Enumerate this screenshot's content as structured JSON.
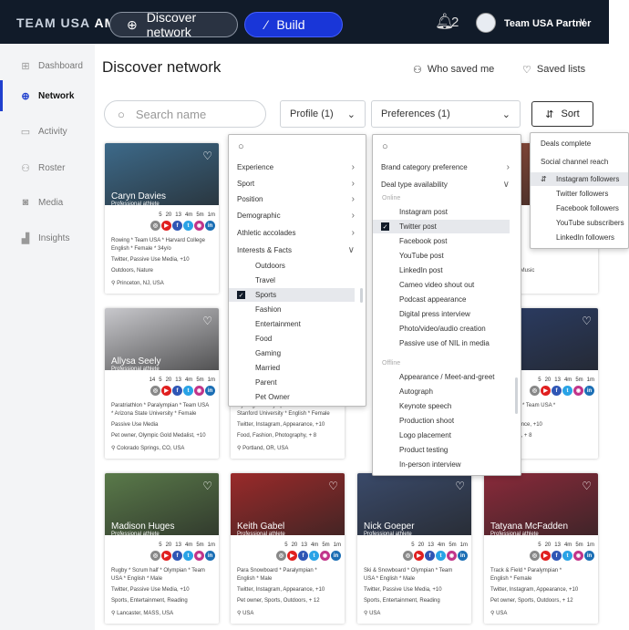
{
  "header": {
    "logo_a": "TEAM USA ",
    "logo_b": "AMP",
    "discover": "Discover network",
    "build": "Build",
    "bell_count": "2",
    "partner": "Team USA Partner"
  },
  "sidebar": {
    "items": [
      {
        "label": "Dashboard",
        "icon": "grid-icon"
      },
      {
        "label": "Network",
        "icon": "globe-icon"
      },
      {
        "label": "Activity",
        "icon": "chat-icon"
      },
      {
        "label": "Roster",
        "icon": "people-icon"
      },
      {
        "label": "Media",
        "icon": "camera-icon"
      },
      {
        "label": "Insights",
        "icon": "bar-chart-icon"
      }
    ]
  },
  "page": {
    "title": "Discover network",
    "who_saved": "Who saved me",
    "saved_lists": "Saved lists"
  },
  "filters": {
    "search_placeholder": "Search name",
    "profile": "Profile (1)",
    "preferences": "Preferences (1)",
    "sort": "Sort"
  },
  "profile_menu": {
    "items": [
      "Experience",
      "Sport",
      "Position",
      "Demographic",
      "Athletic accolades",
      "Interests & Facts"
    ],
    "sub": [
      "Outdoors",
      "Travel",
      "Sports",
      "Fashion",
      "Entertainment",
      "Food",
      "Gaming",
      "Married",
      "Parent",
      "Pet Owner"
    ]
  },
  "pref_menu": {
    "top": [
      "Brand category preference",
      "Deal type availability"
    ],
    "online_label": "Online",
    "online": [
      "Instagram post",
      "Twitter post",
      "Facebook post",
      "YouTube post",
      "LinkedIn post",
      "Cameo video shout out",
      "Podcast appearance",
      "Digital press interview",
      "Photo/video/audio creation",
      "Passive use of NIL in media"
    ],
    "offline_label": "Offline",
    "offline": [
      "Appearance / Meet-and-greet",
      "Autograph",
      "Keynote speech",
      "Production shoot",
      "Logo placement",
      "Product testing",
      "In-person interview"
    ]
  },
  "sort_menu": {
    "top": [
      "Deals complete",
      "Social channel reach"
    ],
    "sub": [
      "Instagram followers",
      "Twitter followers",
      "Facebook followers",
      "YouTube subscribers",
      "LinkedIn followers"
    ]
  },
  "stat_labels": [
    "5",
    "20",
    "13",
    "4m",
    "5m",
    "1m"
  ],
  "stat_labels2": [
    "14",
    "5",
    "20",
    "13",
    "4m",
    "5m",
    "1m"
  ],
  "cards": [
    {
      "name": "Caryn Davies",
      "role": "Professional athlete",
      "l1": "Rowing * Team USA * Harvard College",
      "l2": "English * Female * 34y/o",
      "l3": "Twitter, Passive Use Media, +10",
      "l4": "Outdoors, Nature",
      "loc": "Princeton, NJ, USA"
    },
    {
      "name": "",
      "role": "",
      "l1": "",
      "l2": "",
      "l3": "",
      "l4": "ting, Travel, Music",
      "loc": ""
    },
    {
      "name": "Allysa Seely",
      "role": "Professional athlete",
      "l1": "Paratriathlon * Paralympian * Team USA",
      "l2": "* Arizona State University * Female",
      "l3": "Passive Use Media",
      "l4": "Pet owner, Olympic Gold Medalist, +10",
      "loc": "Colorado Springs, CO, USA"
    },
    {
      "name": "",
      "role": "",
      "l1": "Cycling * Paralympian * Team USA",
      "l2": "Stanford University * English * Female",
      "l3": "Twitter, Instagram, Appearance, +10",
      "l4": "Food, Fashion, Photography, + 8",
      "loc": "Portland, OR, USA"
    },
    {
      "name": "",
      "role": "thlete",
      "l1": "Paralympian * Team USA *",
      "l2": "",
      "l3": "ing, Appearance, +10",
      "l4": "Photography, + 8",
      "loc": "CA, USA"
    },
    {
      "name": "Madison Huges",
      "role": "Professional athlete",
      "l1": "Rugby * Scrum half * Olympian * Team",
      "l2": "USA * English * Male",
      "l3": "Twitter, Passive Use Media, +10",
      "l4": "Sports, Entertainment, Reading",
      "loc": "Lancaster, MASS, USA"
    },
    {
      "name": "Keith Gabel",
      "role": "Professional athlete",
      "l1": "Para Snowboard * Paralympian *",
      "l2": "English * Male",
      "l3": "Twitter, Instagram, Appearance, +10",
      "l4": "Pet owner, Sports, Outdoors, + 12",
      "loc": "USA"
    },
    {
      "name": "Nick Goeper",
      "role": "Professional athlete",
      "l1": "Ski & Snowboard * Olympian * Team",
      "l2": "USA * English * Male",
      "l3": "Twitter, Passive Use Media, +10",
      "l4": "Sports, Entertainment, Reading",
      "loc": "USA"
    },
    {
      "name": "Tatyana McFadden",
      "role": "Professional athlete",
      "l1": "Track & Field * Paralympian *",
      "l2": "English * Female",
      "l3": "Twitter, Instagram, Appearance, +10",
      "l4": "Pet owner, Sports, Outdoors, + 12",
      "loc": "USA"
    }
  ],
  "colors": {
    "accent": "#1936d8",
    "topbar": "#111b29",
    "instagram": "#c1358a",
    "youtube": "#e02020",
    "facebook": "#2f56b5",
    "twitter": "#29a3e6",
    "linkedin": "#1c6fb5"
  }
}
